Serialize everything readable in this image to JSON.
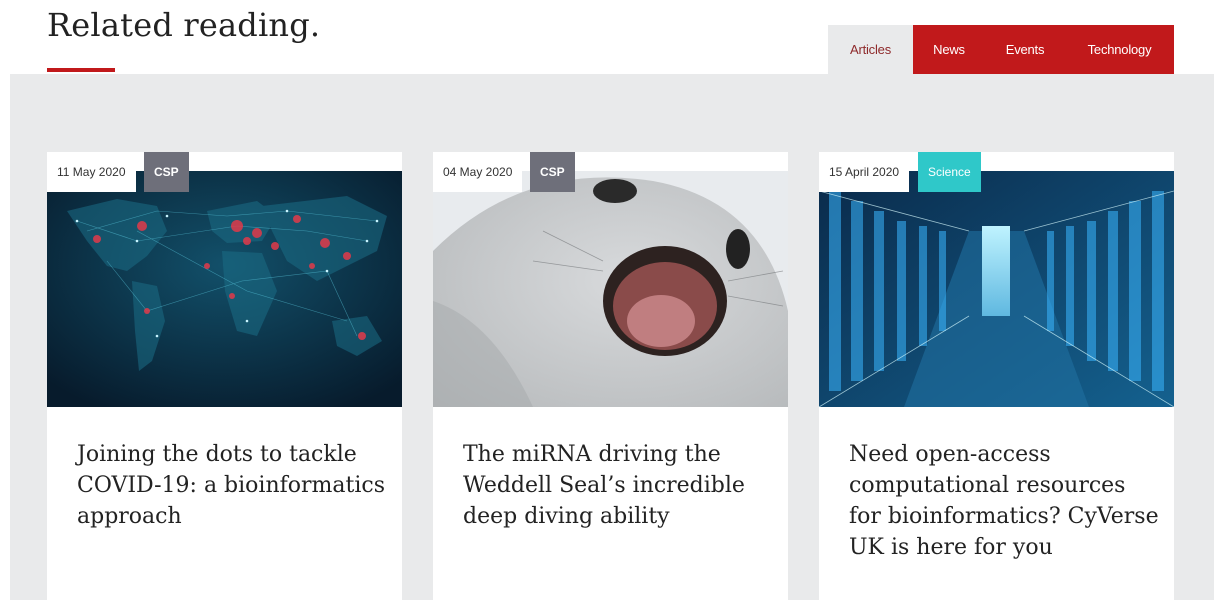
{
  "section": {
    "title": "Related reading."
  },
  "tabs": [
    {
      "label": "Articles",
      "active": true
    },
    {
      "label": "News",
      "active": false
    },
    {
      "label": "Events",
      "active": false
    },
    {
      "label": "Technology",
      "active": false
    }
  ],
  "cards": [
    {
      "date": "11 May 2020",
      "category": "CSP",
      "category_color": "#6e6f7a",
      "image": "world-network-map",
      "headline": "Joining the dots to tackle COVID-19: a bioinformatics approach"
    },
    {
      "date": "04 May 2020",
      "category": "CSP",
      "category_color": "#6e6f7a",
      "image": "weddell-seal",
      "headline": "The miRNA driving the Weddell Seal’s incredible deep diving ability"
    },
    {
      "date": "15 April 2020",
      "category": "Science",
      "category_color": "#2fc8c9",
      "image": "data-center-corridor",
      "headline": "Need open-access computational resources for bioinformatics? CyVerse UK is here for you"
    }
  ],
  "colors": {
    "accent": "#c1191b",
    "band": "#e9eaeb",
    "science": "#2fc8c9",
    "csp": "#6e6f7a"
  }
}
